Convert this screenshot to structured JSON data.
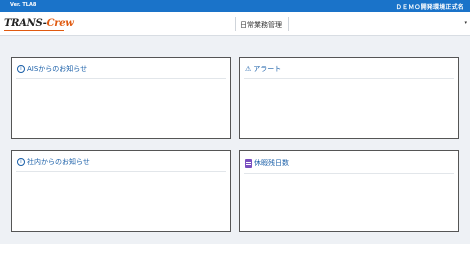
{
  "topbar": {
    "version": "Ver. TLA8",
    "company": "ＤＥＭＯ開発環境正式名"
  },
  "header": {
    "logo_main": "TRANS-",
    "logo_accent": "Crew",
    "menu_title": "日常業務管理",
    "menu_caret": "▾"
  },
  "panels": {
    "ais_news": {
      "icon": "i",
      "title": "AISからのお知らせ"
    },
    "alert": {
      "icon": "⚠",
      "title": "アラート"
    },
    "company_news": {
      "icon": "i",
      "title": "社内からのお知らせ"
    },
    "leave": {
      "title": "休暇残日数"
    }
  },
  "colors": {
    "brand": "#1a73c9",
    "title": "#1a5fa8",
    "accent": "#e05a10",
    "doc_icon": "#7a4fc0"
  }
}
